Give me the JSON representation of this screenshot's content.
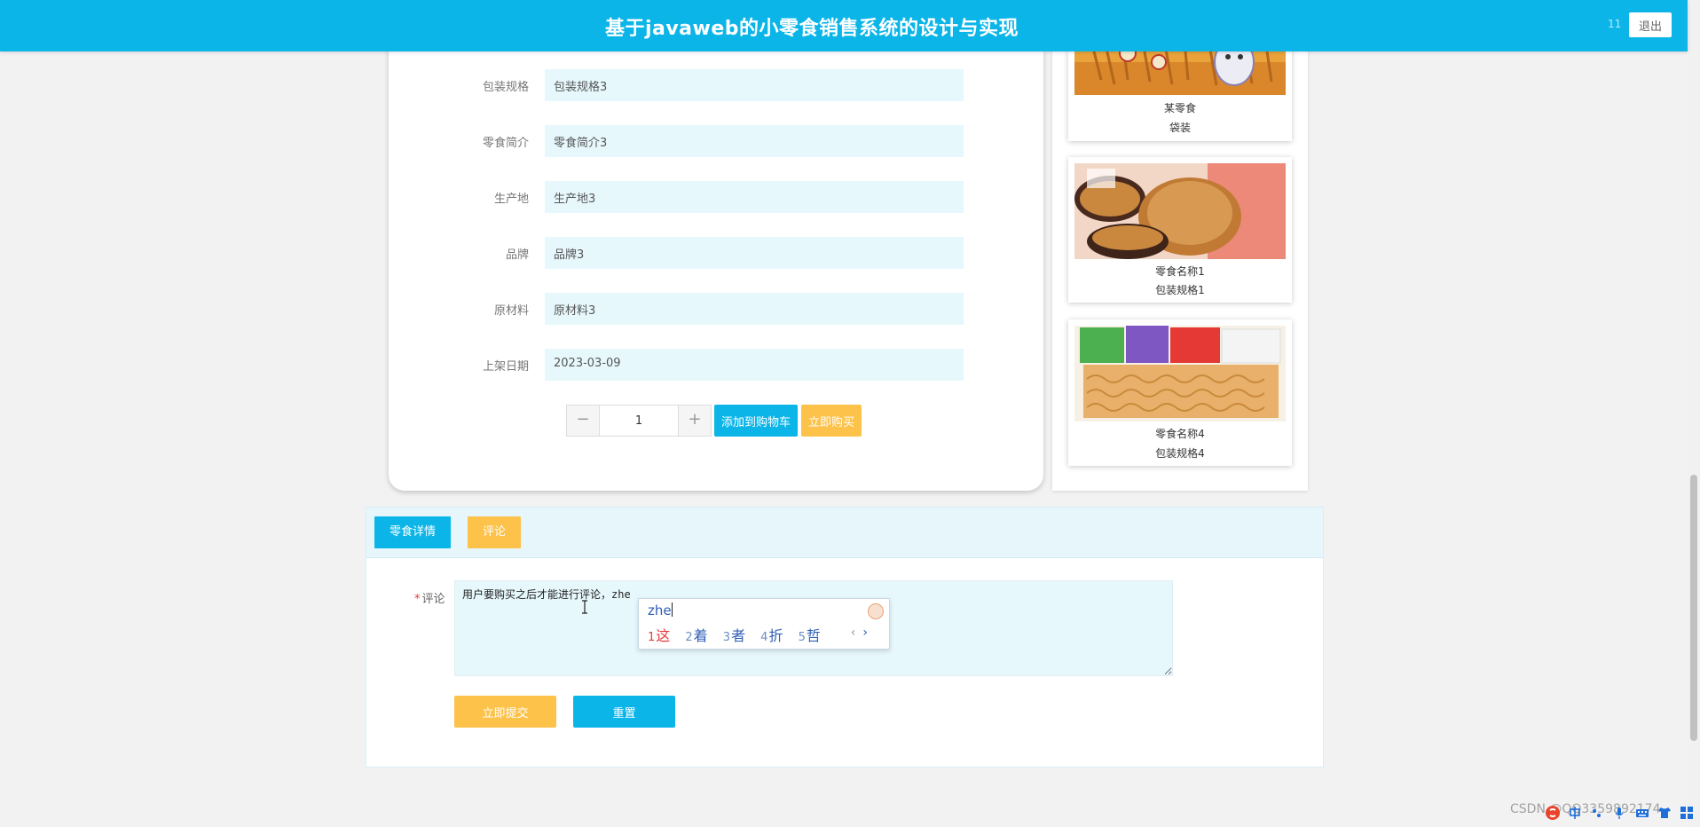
{
  "header": {
    "title": "基于javaweb的小零食销售系统的设计与实现",
    "username": "11",
    "logout_label": "退出"
  },
  "product_form": {
    "fields": [
      {
        "label": "包装规格",
        "value": "包装规格3"
      },
      {
        "label": "零食简介",
        "value": "零食简介3"
      },
      {
        "label": "生产地",
        "value": "生产地3"
      },
      {
        "label": "品牌",
        "value": "品牌3"
      },
      {
        "label": "原材料",
        "value": "原材料3"
      },
      {
        "label": "上架日期",
        "value": "2023-03-09"
      }
    ],
    "quantity": "1",
    "minus_label": "−",
    "plus_label": "+",
    "add_to_cart_label": "添加到购物车",
    "buy_now_label": "立即购买"
  },
  "recommendations": [
    {
      "name": "某零食",
      "spec": "袋装"
    },
    {
      "name": "零食名称1",
      "spec": "包装规格1"
    },
    {
      "name": "零食名称4",
      "spec": "包装规格4"
    }
  ],
  "tabs": {
    "details_label": "零食详情",
    "comments_label": "评论"
  },
  "comment_form": {
    "required_mark": "*",
    "label": "评论",
    "text": "用户要购买之后才能进行评论，zhe",
    "submit_label": "立即提交",
    "reset_label": "重置"
  },
  "ime": {
    "pinyin": "zhe",
    "candidates": [
      {
        "num": "1",
        "char": "这"
      },
      {
        "num": "2",
        "char": "着"
      },
      {
        "num": "3",
        "char": "者"
      },
      {
        "num": "4",
        "char": "折"
      },
      {
        "num": "5",
        "char": "哲"
      }
    ],
    "prev_label": "‹",
    "next_label": "›"
  },
  "watermark": "CSDN @QQ3359892174",
  "colors": {
    "primary": "#0bb5e8",
    "accent": "#fdc24a",
    "field_bg": "#e7f8fd",
    "page_bg": "#f2f2f2"
  }
}
